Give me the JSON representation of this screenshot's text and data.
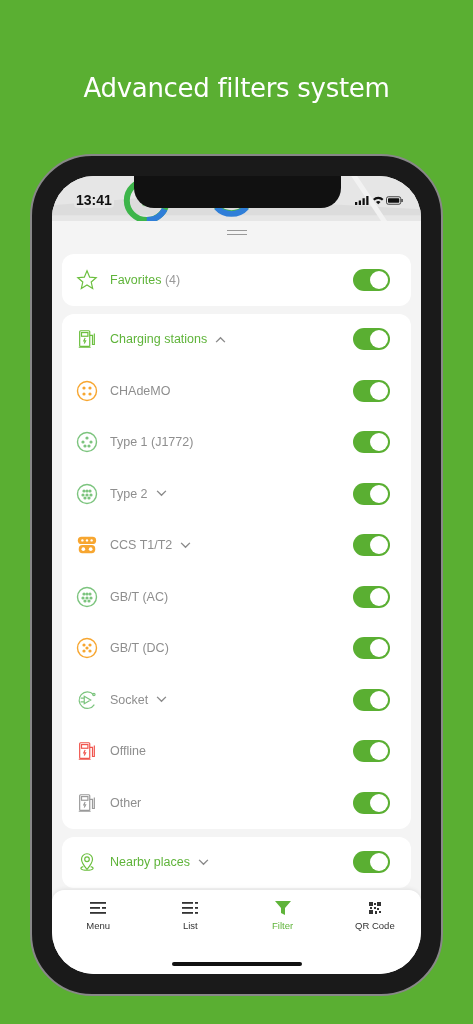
{
  "headline": "Advanced filters system",
  "status_bar": {
    "time": "13:41"
  },
  "sections": [
    {
      "kind": "favorites",
      "label": "Favorites",
      "count": "(4)",
      "on": true
    },
    {
      "kind": "stations",
      "label": "Charging stations",
      "expanded": true,
      "on": true,
      "items": [
        {
          "kind": "chademo",
          "label": "CHAdeMO",
          "expandable": false,
          "on": true
        },
        {
          "kind": "type1",
          "label": "Type 1 (J1772)",
          "expandable": false,
          "on": true
        },
        {
          "kind": "type2",
          "label": "Type 2",
          "expandable": true,
          "expanded": false,
          "on": true
        },
        {
          "kind": "ccs",
          "label": "CCS T1/T2",
          "expandable": true,
          "expanded": false,
          "on": true
        },
        {
          "kind": "gbt_ac",
          "label": "GB/T (AC)",
          "expandable": false,
          "on": true
        },
        {
          "kind": "gbt_dc",
          "label": "GB/T (DC)",
          "expandable": false,
          "on": true
        },
        {
          "kind": "socket",
          "label": "Socket",
          "expandable": true,
          "expanded": false,
          "on": true
        },
        {
          "kind": "offline",
          "label": "Offline",
          "expandable": false,
          "on": true
        },
        {
          "kind": "other",
          "label": "Other",
          "expandable": false,
          "on": true
        }
      ]
    },
    {
      "kind": "places",
      "label": "Nearby places",
      "expanded": false,
      "on": true
    }
  ],
  "tabs": [
    {
      "kind": "menu",
      "label": "Menu",
      "selected": false
    },
    {
      "kind": "list",
      "label": "List",
      "selected": false
    },
    {
      "kind": "filter",
      "label": "Filter",
      "selected": true
    },
    {
      "kind": "qr",
      "label": "QR Code",
      "selected": false
    }
  ]
}
